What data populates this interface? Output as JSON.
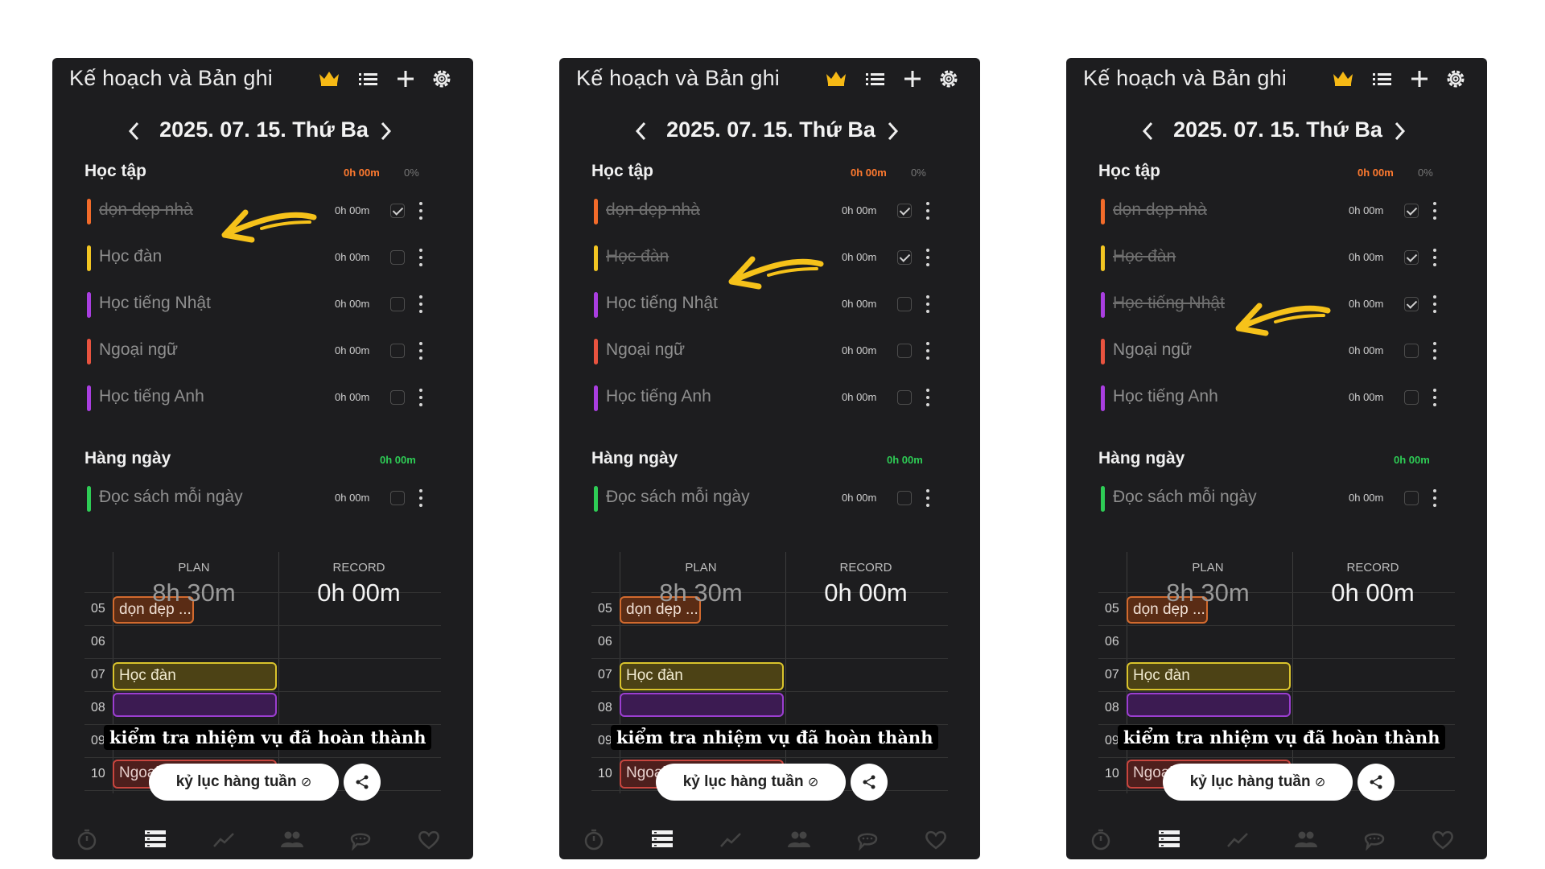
{
  "app": {
    "title": "Kế hoạch và Bản ghi",
    "date": "2025. 07. 15. Thứ Ba"
  },
  "sections": {
    "study": {
      "name": "Học tập",
      "time": "0h 00m",
      "percent": "0%"
    },
    "daily": {
      "name": "Hàng ngày",
      "time": "0h 00m"
    }
  },
  "tasks": [
    {
      "label": "dọn dẹp nhà",
      "time": "0h 00m",
      "color": "#f26b2a"
    },
    {
      "label": "Học đàn",
      "time": "0h 00m",
      "color": "#f2c522"
    },
    {
      "label": "Học tiếng Nhật",
      "time": "0h 00m",
      "color": "#a93ee0"
    },
    {
      "label": "Ngoại ngữ",
      "time": "0h 00m",
      "color": "#e8533f"
    },
    {
      "label": "Học tiếng Anh",
      "time": "0h 00m",
      "color": "#a93ee0"
    },
    {
      "label": "Đọc sách mỗi ngày",
      "time": "0h 00m",
      "color": "#2ecc55"
    }
  ],
  "panels": [
    {
      "completed": [
        true,
        false,
        false,
        false,
        false,
        false
      ]
    },
    {
      "completed": [
        true,
        true,
        false,
        false,
        false,
        false
      ]
    },
    {
      "completed": [
        true,
        true,
        true,
        false,
        false,
        false
      ]
    }
  ],
  "stats": {
    "plan_label": "PLAN",
    "plan_value": "8h 30m",
    "record_label": "RECORD",
    "record_value": "0h 00m"
  },
  "timeline": {
    "hours": [
      "05",
      "06",
      "07",
      "08",
      "09",
      "10"
    ],
    "blocks": {
      "b05": "dọn dẹp ...",
      "b07": "Học đàn",
      "b10": "Ngoại ngữ"
    }
  },
  "caption": "kiểm tra nhiệm vụ đã hoàn thành",
  "buttons": {
    "weekly": "kỷ lục hàng tuần"
  },
  "icons": [
    "crown-icon",
    "list-icon",
    "plus-icon",
    "gear-icon",
    "chevron-left-icon",
    "chevron-right-icon",
    "timer-icon",
    "plan-icon",
    "chart-icon",
    "friends-icon",
    "chat-icon",
    "heart-icon",
    "share-icon",
    "arrow-annotation"
  ]
}
